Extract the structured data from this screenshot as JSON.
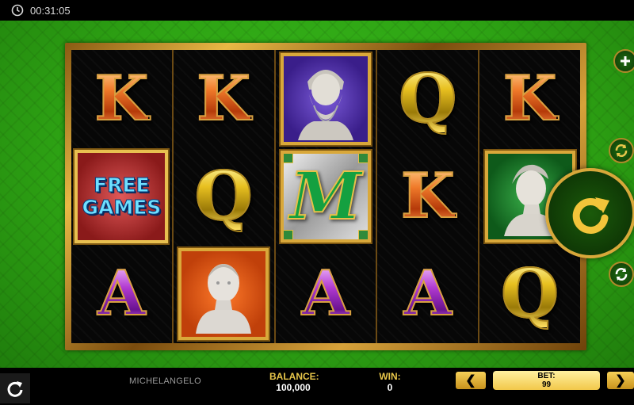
{
  "topbar": {
    "time": "00:31:05",
    "icon": "clock-icon"
  },
  "reels": [
    [
      "K",
      "FREE GAMES",
      "A"
    ],
    [
      "K",
      "Q",
      "woman-bust"
    ],
    [
      "zeus-bust",
      "M",
      "A"
    ],
    [
      "Q",
      "K",
      "A"
    ],
    [
      "K",
      "david-bust",
      "Q"
    ]
  ],
  "symbols": {
    "k": "K",
    "q": "Q",
    "a": "A",
    "m": "M",
    "free_line1": "FREE",
    "free_line2": "GAMES"
  },
  "controls": {
    "plus_icon": "plus-icon",
    "autoplay_icon": "autoplay-icon",
    "spin_icon": "spin-arrow-icon",
    "refresh_icon": "refresh-icon"
  },
  "bottombar": {
    "game_name": "MICHELANGELO",
    "balance_label": "BALANCE:",
    "balance_value": "100,000",
    "win_label": "WIN:",
    "win_value": "0",
    "bet_label": "BET:",
    "bet_value": "99",
    "bet_decrease": "❮",
    "bet_increase": "❯"
  },
  "colors": {
    "felt_green": "#2ea414",
    "gold": "#d9a83a",
    "text_gold": "#e8c64a"
  }
}
